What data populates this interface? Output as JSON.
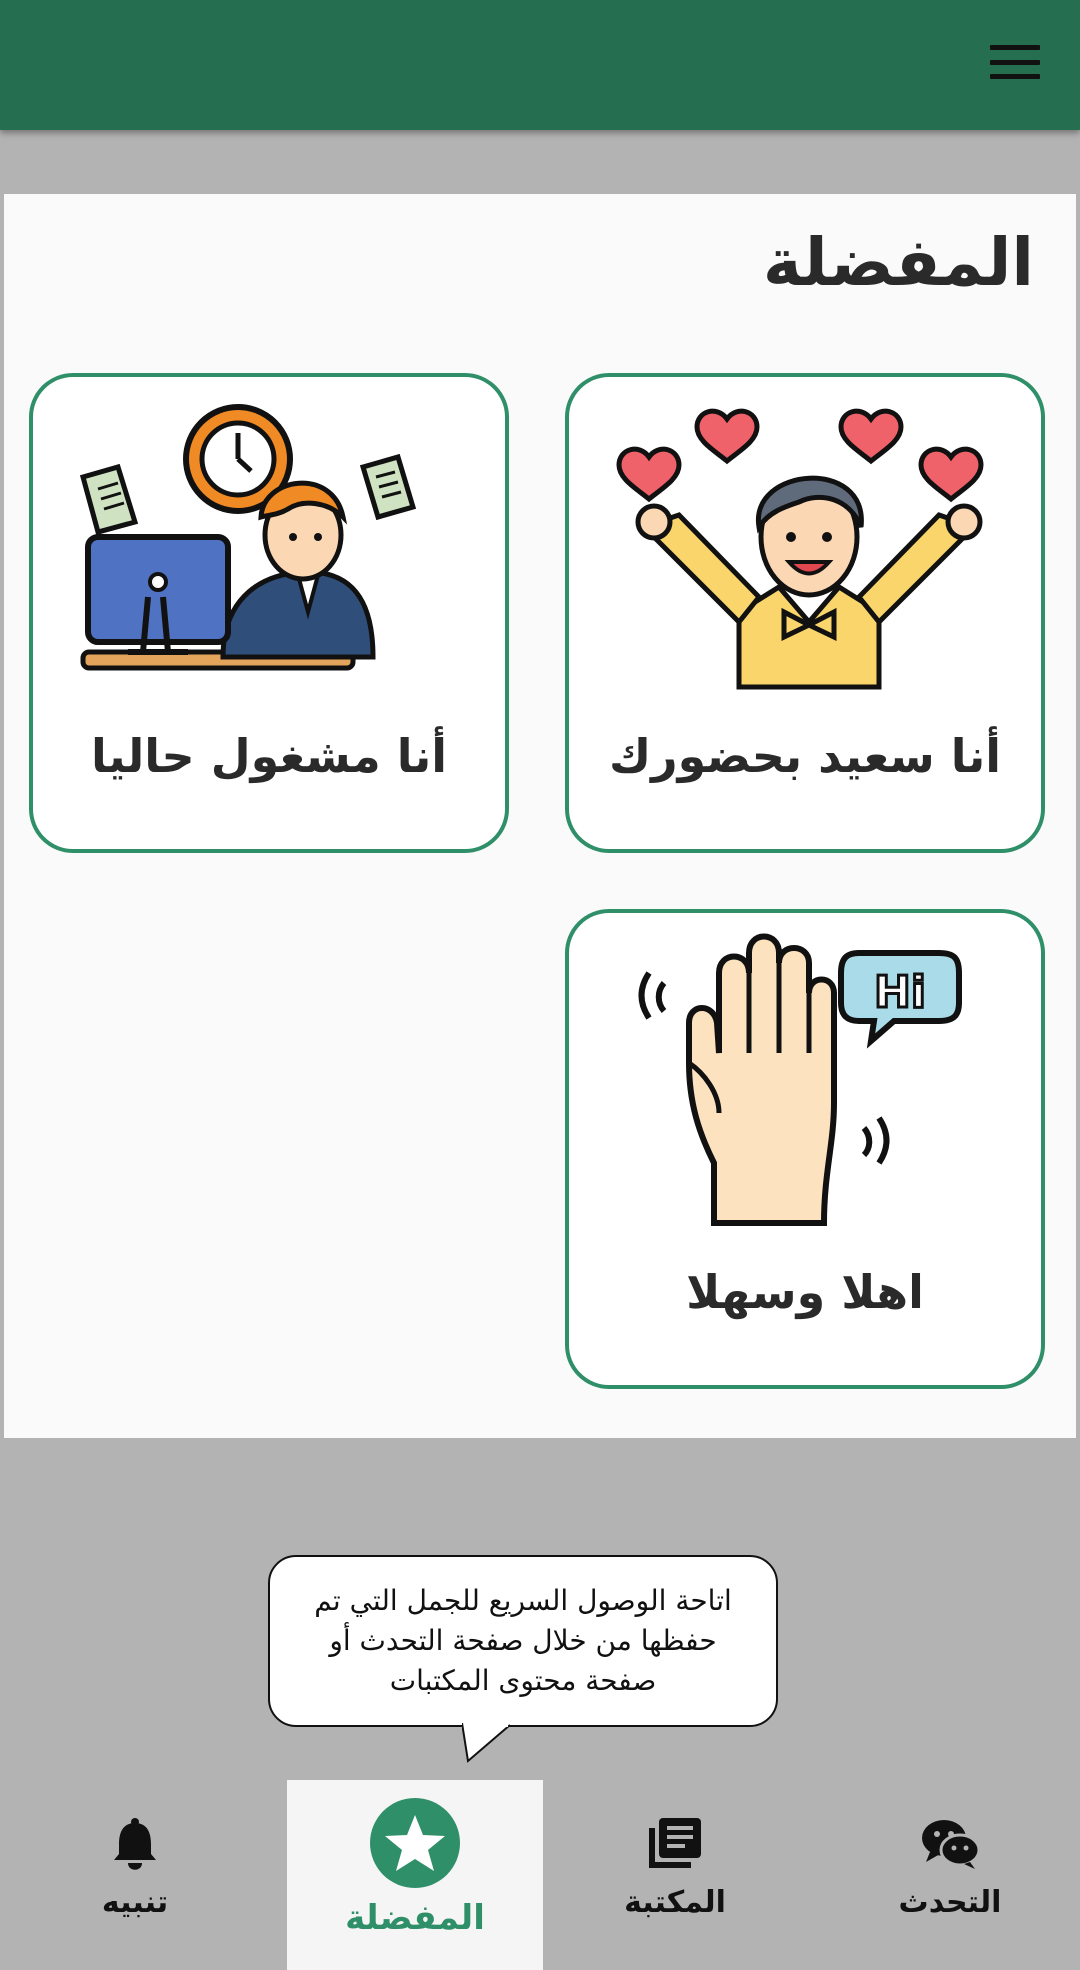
{
  "appbar": {
    "menu_icon": "hamburger-menu-icon"
  },
  "page": {
    "title": "المفضلة"
  },
  "cards": [
    {
      "label": "أنا سعيد بحضورك",
      "icon": "happy-person-hearts-icon"
    },
    {
      "label": "أنا مشغول حاليا",
      "icon": "busy-office-worker-icon"
    },
    {
      "label": "اهلا وسهلا",
      "icon": "waving-hand-hi-icon"
    }
  ],
  "tooltip": {
    "line1": "اتاحة الوصول السريع للجمل التي تم",
    "line2": "حفظها من خلال صفحة التحدث أو",
    "line3": "صفحة محتوى المكتبات"
  },
  "nav": {
    "items": [
      {
        "label": "التحدث",
        "icon": "wechat-icon"
      },
      {
        "label": "المكتبة",
        "icon": "library-books-icon"
      },
      {
        "label": "المفضلة",
        "icon": "star-icon",
        "active": true
      },
      {
        "label": "تنبيه",
        "icon": "bell-icon"
      }
    ]
  },
  "colors": {
    "primary": "#256f50",
    "accent": "#2f8f69",
    "background": "#b3b3b3",
    "panel": "#fafafa"
  }
}
